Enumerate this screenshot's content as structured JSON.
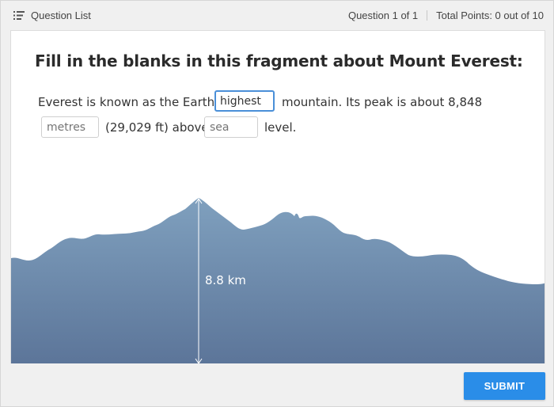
{
  "header": {
    "question_list_label": "Question List",
    "question_counter": "Question 1 of 1",
    "total_points": "Total Points: 0 out of 10"
  },
  "question": {
    "title": "Fill in the blanks in this fragment about Mount Everest:",
    "text_part1": "Everest is known as the Earth's",
    "text_part2": "mountain. Its peak is about 8,848",
    "text_part3": "(29,029 ft) above",
    "text_part4": "level.",
    "blanks": [
      {
        "value": "highest",
        "placeholder": ""
      },
      {
        "value": "",
        "placeholder": "metres"
      },
      {
        "value": "",
        "placeholder": "sea"
      }
    ]
  },
  "illustration": {
    "height_label": "8.8 km",
    "icon": "mountain-silhouette"
  },
  "footer": {
    "submit_label": "SUBMIT"
  },
  "colors": {
    "accent": "#2a8de8",
    "focus": "#4a8fd8",
    "mountain_top": "#7e9fbd",
    "mountain_bottom": "#5d7699"
  }
}
